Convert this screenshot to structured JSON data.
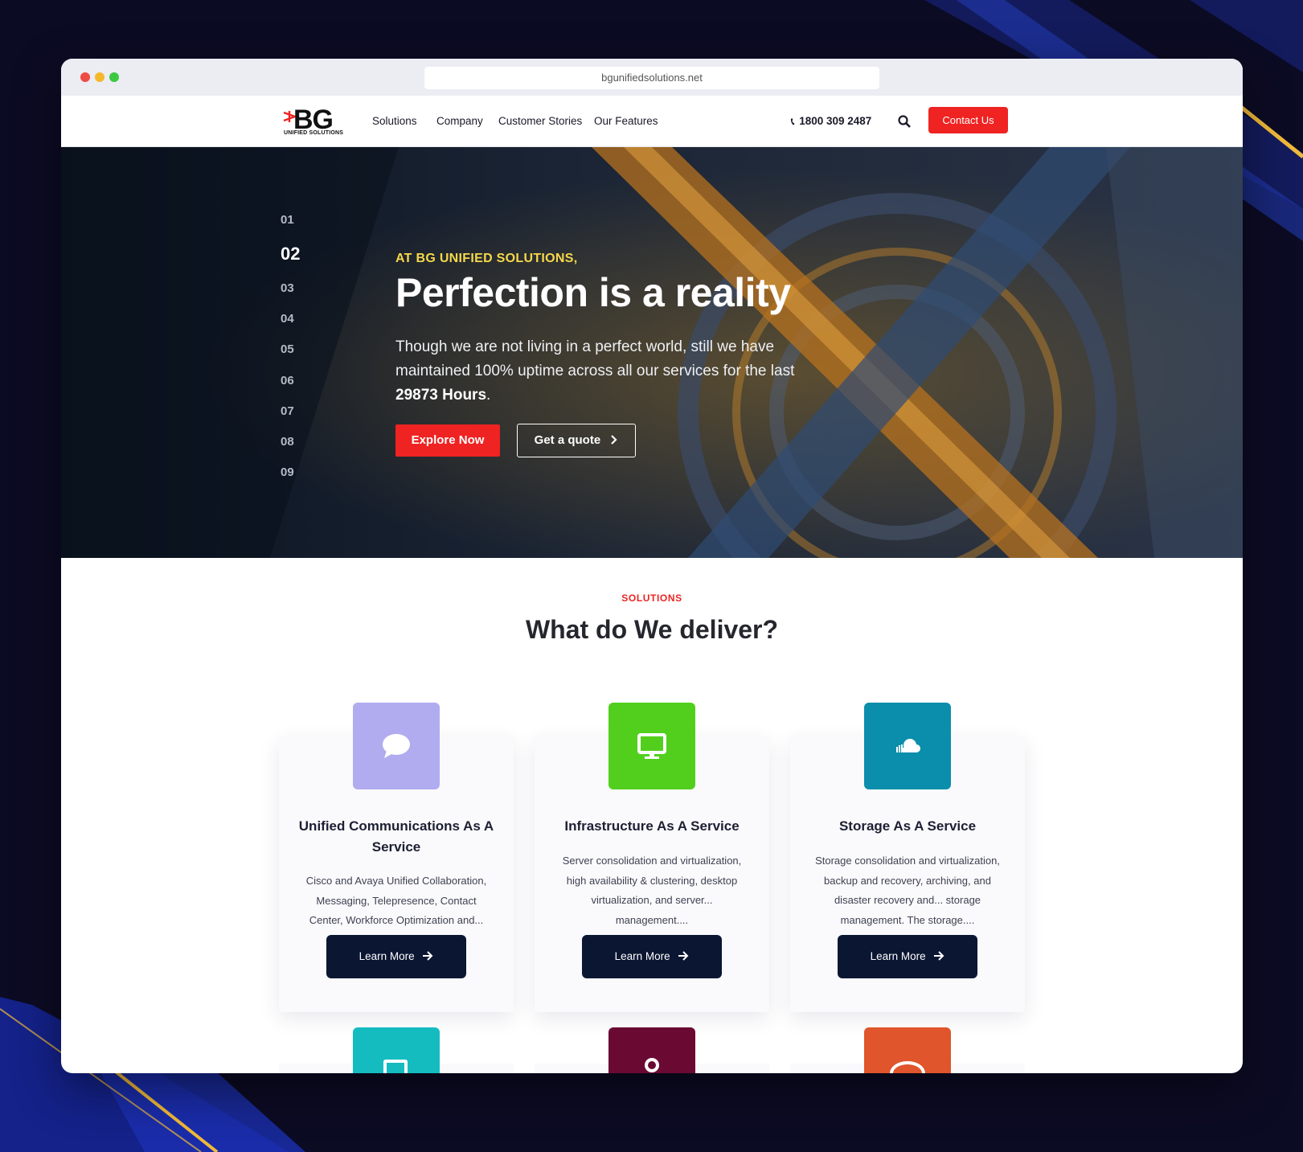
{
  "browser": {
    "url": "bgunifiedsolutions.net"
  },
  "nav": {
    "logo_text": "BG",
    "logo_sub": "UNIFIED SOLUTIONS",
    "links": [
      "Solutions",
      "Company",
      "Customer Stories",
      "Our Features"
    ],
    "phone": "1800 309 2487",
    "contact_label": "Contact Us"
  },
  "hero": {
    "slides": [
      "01",
      "02",
      "03",
      "04",
      "05",
      "06",
      "07",
      "08",
      "09"
    ],
    "active_slide": "02",
    "eyebrow": "AT BG UNIFIED SOLUTIONS,",
    "title": "Perfection is a reality",
    "description": "Though we are not living in a perfect world, still we have maintained 100% uptime across all our services for the last",
    "highlight": "29873 Hours",
    "highlight_suffix": ".",
    "explore_label": "Explore Now",
    "quote_label": "Get a quote"
  },
  "solutions": {
    "label": "SOLUTIONS",
    "title": "What do We deliver?",
    "cards": [
      {
        "title": "Unified Communications As A Service",
        "description": "Cisco and Avaya Unified Collaboration, Messaging, Telepresence, Contact Center, Workforce Optimization and...",
        "button": "Learn More",
        "icon": "chat-bubble-icon",
        "color": "#b1acf0"
      },
      {
        "title": "Infrastructure As A Service",
        "description": "Server consolidation and virtualization, high availability & clustering, desktop virtualization, and server... management....",
        "button": "Learn More",
        "icon": "desktop-icon",
        "color": "#52cf1d"
      },
      {
        "title": "Storage As A Service",
        "description": "Storage consolidation and virtualization, backup and recovery, archiving, and disaster recovery and... storage management. The storage....",
        "button": "Learn More",
        "icon": "cloud-icon",
        "color": "#0a8eab"
      }
    ],
    "next_row_colors": [
      "#14bcc0",
      "#6a0a33",
      "#e0552b"
    ]
  },
  "colors": {
    "accent": "#ee2322",
    "navy": "#0b1633",
    "eyebrow": "#f6d84a"
  }
}
